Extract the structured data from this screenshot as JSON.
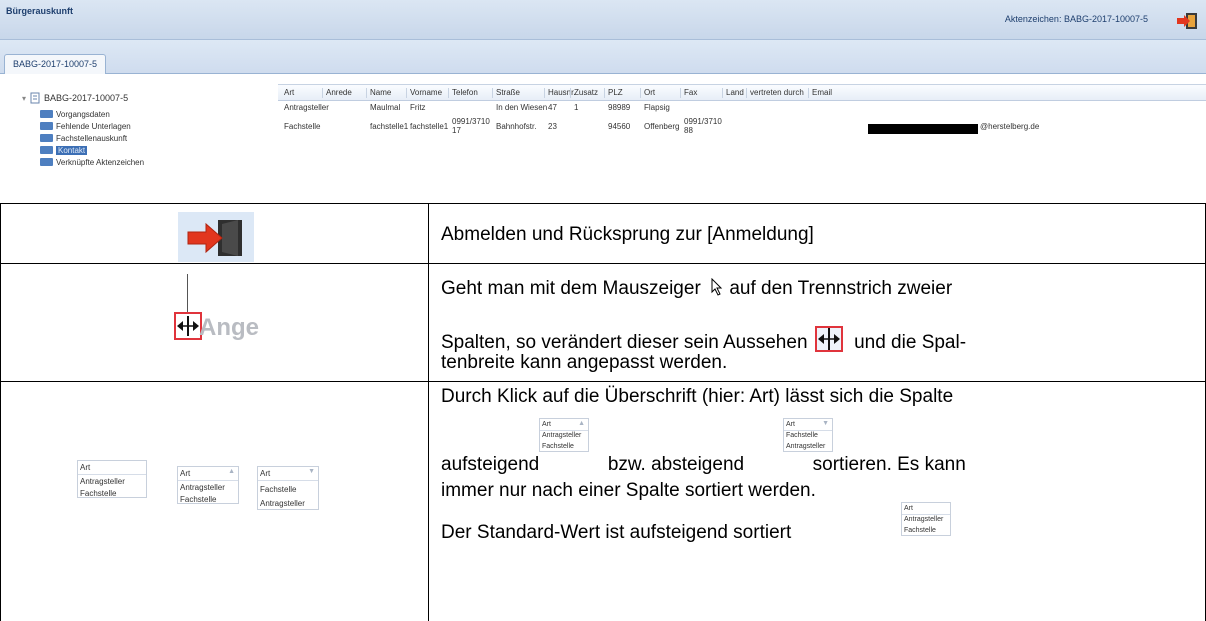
{
  "app": {
    "title": "Bürgerauskunft",
    "file_label": "Aktenzeichen: BABG-2017-10007-5",
    "tab": "BABG-2017-10007-5",
    "tree": {
      "root": "BABG-2017-10007-5",
      "items": [
        "Vorgangsdaten",
        "Fehlende Unterlagen",
        "Fachstellenauskunft",
        "Kontakt",
        "Verknüpfte Aktenzeichen"
      ],
      "selected_index": 3
    },
    "grid": {
      "columns": [
        "Art",
        "Anrede",
        "Name",
        "Vorname",
        "Telefon",
        "Straße",
        "Hausnr.",
        "Zusatz",
        "PLZ",
        "Ort",
        "Fax",
        "Land",
        "vertreten durch",
        "Email"
      ],
      "rows": [
        [
          "Antragsteller",
          "",
          "Maulmal",
          "Fritz",
          "",
          "In den Wiesen",
          "47",
          "1",
          "98989",
          "Flapsig",
          "",
          "",
          "",
          ""
        ],
        [
          "Fachstelle",
          "",
          "fachstelle1",
          "fachstelle1",
          "0991/3710 17",
          "Bahnhofstr.",
          "23",
          "",
          "94560",
          "Offenberg",
          "0991/3710 88",
          "",
          "",
          "@herstelberg.de"
        ]
      ]
    }
  },
  "doc": {
    "row1": {
      "text": "Abmelden und Rücksprung zur [Anmeldung]"
    },
    "row2": {
      "example_label": "Ange",
      "text_a": "Geht man mit dem Mauszeiger",
      "text_b": "auf den Trennstrich zweier",
      "text_c": "Spalten, so verändert dieser sein Aussehen",
      "text_d": "und die Spal-",
      "text_e": "tenbreite kann angepasst werden."
    },
    "row3": {
      "line1": "Durch Klick auf die Überschrift (hier: Art) lässt sich die Spalte",
      "line2a": "aufsteigend",
      "line2b": "bzw. absteigend",
      "line2c": "sortieren. Es kann",
      "line3": "immer nur nach einer Spalte sortiert werden.",
      "line4": "Der Standard-Wert ist aufsteigend sortiert",
      "sort_header": "Art",
      "sort_rows_asc": [
        "Antragsteller",
        "Fachstelle"
      ],
      "sort_rows_desc": [
        "Fachstelle",
        "Antragsteller"
      ]
    }
  },
  "colors": {
    "accent": "#3c6fb5",
    "titlebar": "#c8d7ea",
    "logout_arrow": "#e2361e"
  }
}
